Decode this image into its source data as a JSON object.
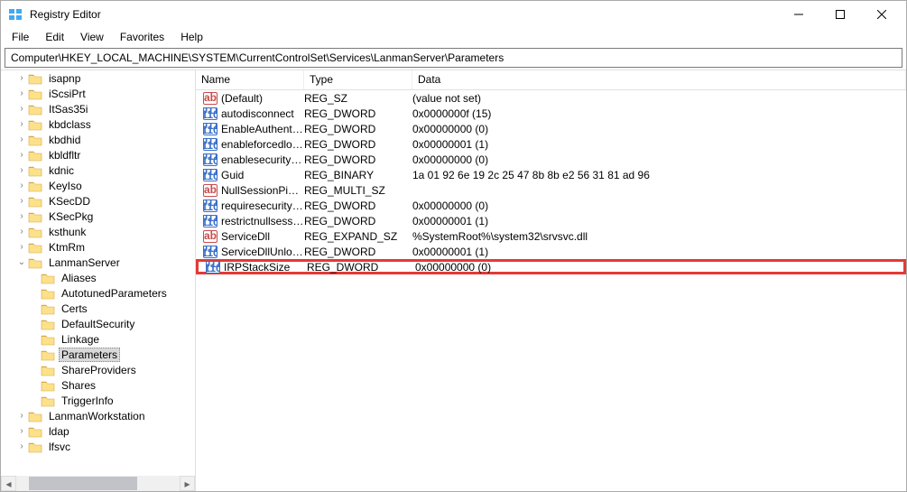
{
  "window": {
    "title": "Registry Editor"
  },
  "menu": {
    "file": "File",
    "edit": "Edit",
    "view": "View",
    "favorites": "Favorites",
    "help": "Help"
  },
  "address": "Computer\\HKEY_LOCAL_MACHINE\\SYSTEM\\CurrentControlSet\\Services\\LanmanServer\\Parameters",
  "columns": {
    "name": "Name",
    "type": "Type",
    "data": "Data"
  },
  "tree": [
    {
      "indent": 4,
      "arrow": ">",
      "label": "isapnp"
    },
    {
      "indent": 4,
      "arrow": ">",
      "label": "iScsiPrt"
    },
    {
      "indent": 4,
      "arrow": ">",
      "label": "ItSas35i"
    },
    {
      "indent": 4,
      "arrow": ">",
      "label": "kbdclass"
    },
    {
      "indent": 4,
      "arrow": ">",
      "label": "kbdhid"
    },
    {
      "indent": 4,
      "arrow": ">",
      "label": "kbldfltr"
    },
    {
      "indent": 4,
      "arrow": ">",
      "label": "kdnic"
    },
    {
      "indent": 4,
      "arrow": ">",
      "label": "KeyIso"
    },
    {
      "indent": 4,
      "arrow": ">",
      "label": "KSecDD"
    },
    {
      "indent": 4,
      "arrow": ">",
      "label": "KSecPkg"
    },
    {
      "indent": 4,
      "arrow": ">",
      "label": "ksthunk"
    },
    {
      "indent": 4,
      "arrow": ">",
      "label": "KtmRm"
    },
    {
      "indent": 4,
      "arrow": "v",
      "label": "LanmanServer"
    },
    {
      "indent": 5,
      "arrow": "",
      "label": "Aliases"
    },
    {
      "indent": 5,
      "arrow": "",
      "label": "AutotunedParameters"
    },
    {
      "indent": 5,
      "arrow": "",
      "label": "Certs"
    },
    {
      "indent": 5,
      "arrow": "",
      "label": "DefaultSecurity"
    },
    {
      "indent": 5,
      "arrow": "",
      "label": "Linkage"
    },
    {
      "indent": 5,
      "arrow": "",
      "label": "Parameters",
      "selected": true
    },
    {
      "indent": 5,
      "arrow": "",
      "label": "ShareProviders"
    },
    {
      "indent": 5,
      "arrow": "",
      "label": "Shares"
    },
    {
      "indent": 5,
      "arrow": "",
      "label": "TriggerInfo"
    },
    {
      "indent": 4,
      "arrow": ">",
      "label": "LanmanWorkstation"
    },
    {
      "indent": 4,
      "arrow": ">",
      "label": "ldap"
    },
    {
      "indent": 4,
      "arrow": ">",
      "label": "lfsvc"
    }
  ],
  "values": [
    {
      "icon": "str",
      "name": "(Default)",
      "type": "REG_SZ",
      "data": "(value not set)"
    },
    {
      "icon": "bin",
      "name": "autodisconnect",
      "type": "REG_DWORD",
      "data": "0x0000000f (15)"
    },
    {
      "icon": "bin",
      "name": "EnableAuthentic...",
      "type": "REG_DWORD",
      "data": "0x00000000 (0)"
    },
    {
      "icon": "bin",
      "name": "enableforcedlog...",
      "type": "REG_DWORD",
      "data": "0x00000001 (1)"
    },
    {
      "icon": "bin",
      "name": "enablesecuritysi...",
      "type": "REG_DWORD",
      "data": "0x00000000 (0)"
    },
    {
      "icon": "bin",
      "name": "Guid",
      "type": "REG_BINARY",
      "data": "1a 01 92 6e 19 2c 25 47 8b 8b e2 56 31 81 ad 96"
    },
    {
      "icon": "str",
      "name": "NullSessionPipes",
      "type": "REG_MULTI_SZ",
      "data": ""
    },
    {
      "icon": "bin",
      "name": "requiresecuritysi...",
      "type": "REG_DWORD",
      "data": "0x00000000 (0)"
    },
    {
      "icon": "bin",
      "name": "restrictnullsessa...",
      "type": "REG_DWORD",
      "data": "0x00000001 (1)"
    },
    {
      "icon": "str",
      "name": "ServiceDll",
      "type": "REG_EXPAND_SZ",
      "data": "%SystemRoot%\\system32\\srvsvc.dll"
    },
    {
      "icon": "bin",
      "name": "ServiceDllUnloa...",
      "type": "REG_DWORD",
      "data": "0x00000001 (1)"
    },
    {
      "icon": "bin",
      "name": "IRPStackSize",
      "type": "REG_DWORD",
      "data": "0x00000000 (0)",
      "highlight": true
    }
  ]
}
